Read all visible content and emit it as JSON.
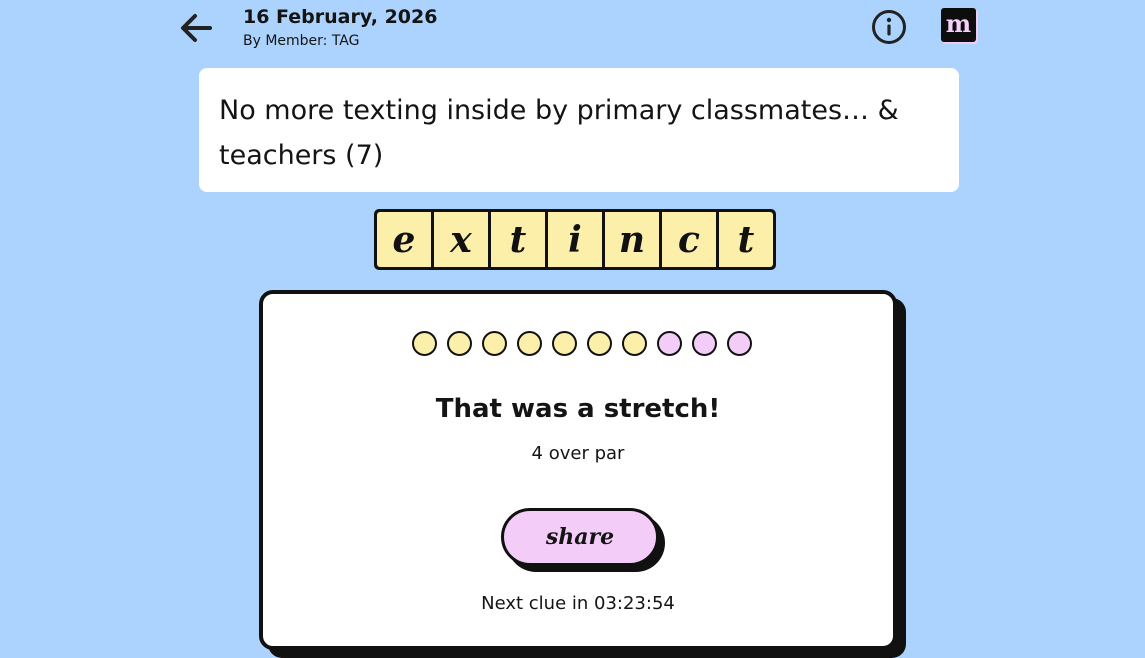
{
  "header": {
    "date": "16 February, 2026",
    "author": "By Member: TAG",
    "back_icon": "arrow-left-icon",
    "info_icon": "info-circle-icon",
    "logo_letter": "m"
  },
  "clue": {
    "text": "No more texting inside by primary classmates… & teachers (7)"
  },
  "answer": {
    "letters": [
      "e",
      "x",
      "t",
      "i",
      "n",
      "c",
      "t"
    ]
  },
  "result": {
    "attempts_used": 7,
    "attempts_total": 10,
    "title": "That was a stretch!",
    "subtitle": "4 over par",
    "share_label": "share",
    "next_clue": "Next clue in 03:23:54"
  },
  "colors": {
    "background": "#acd3fd",
    "tile": "#fcefaa",
    "dot_used": "#fcefaa",
    "dot_unused": "#f3cdf7",
    "share_button": "#f3cdf7"
  }
}
